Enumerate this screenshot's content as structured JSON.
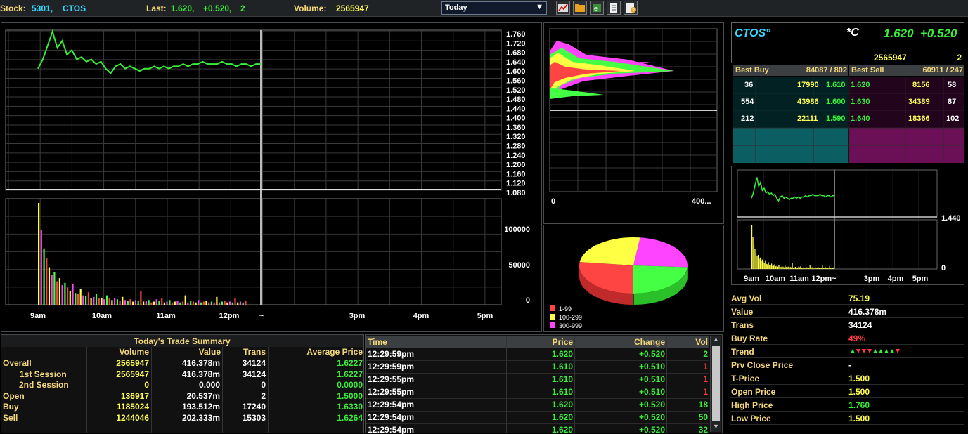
{
  "topbar": {
    "stock_label": "Stock:",
    "stock_code": "5301,",
    "stock_name": "CTOS",
    "last_label": "Last:",
    "last_price": "1.620,",
    "last_change": "+0.520,",
    "last_vol": "2",
    "volume_label": "Volume:",
    "volume": "2565947",
    "period": "Today",
    "icons": [
      "chart-icon",
      "folder-icon",
      "export-icon",
      "document-icon",
      "help-icon"
    ]
  },
  "price_chart": {
    "price_axis": [
      "1.760",
      "1.720",
      "1.680",
      "1.640",
      "1.600",
      "1.560",
      "1.520",
      "1.480",
      "1.440",
      "1.400",
      "1.360",
      "1.320",
      "1.280",
      "1.240",
      "1.200",
      "1.160",
      "1.120",
      "1.080"
    ],
    "volume_axis": [
      "100000",
      "50000",
      "0"
    ],
    "time_axis": [
      "9am",
      "10am",
      "11am",
      "12pm",
      "~",
      "3pm",
      "4pm",
      "5pm"
    ]
  },
  "chart_data": [
    {
      "type": "line",
      "name": "intraday-price",
      "x_range": [
        "9am",
        "5pm"
      ],
      "ylim": [
        1.08,
        1.76
      ],
      "prices": [
        1.6,
        1.64,
        1.7,
        1.76,
        1.69,
        1.72,
        1.66,
        1.68,
        1.64,
        1.65,
        1.63,
        1.64,
        1.62,
        1.63,
        1.6,
        1.58,
        1.61,
        1.62,
        1.6,
        1.61,
        1.6,
        1.59,
        1.6,
        1.6,
        1.61,
        1.6,
        1.61,
        1.6,
        1.61,
        1.61,
        1.62,
        1.61,
        1.62,
        1.62,
        1.63,
        1.62,
        1.62,
        1.62,
        1.63,
        1.62,
        1.62,
        1.61,
        1.62,
        1.62,
        1.61,
        1.62,
        1.62
      ]
    },
    {
      "type": "bar",
      "name": "intraday-volume",
      "ylim": [
        0,
        130000
      ],
      "values": [
        130000,
        95000,
        72000,
        60000,
        48000,
        38000,
        42000,
        30000,
        34000,
        25000,
        28000,
        22000,
        18000,
        26000,
        15000,
        14000,
        20000,
        12000,
        11000,
        16000,
        9000,
        10000,
        14000,
        8000,
        9000,
        7000,
        12000,
        8000,
        6000,
        9000,
        7000,
        5000,
        10000,
        6000,
        5000,
        7000,
        4000,
        6000,
        5000,
        18000,
        4000,
        5000,
        6000,
        3000,
        4000,
        7000,
        5000,
        8000,
        3000,
        4000,
        6000,
        3000,
        4000,
        5000,
        3000,
        4000,
        12000,
        3000,
        5000,
        4000,
        3000,
        6000,
        3000,
        4000,
        5000,
        3000,
        4000,
        3000,
        10000,
        3000,
        4000,
        5000,
        3000,
        4000,
        3000,
        9000,
        3000,
        4000,
        3000,
        5000
      ]
    },
    {
      "type": "area",
      "name": "volume-at-price",
      "x_axis": [
        "0",
        "400..."
      ]
    },
    {
      "type": "pie",
      "name": "trade-size-distribution",
      "categories": [
        "1-99",
        "100-299",
        "300-999"
      ],
      "values": [
        27,
        25,
        24,
        24
      ],
      "colors": [
        "#ff4444",
        "#ffff44",
        "#ff44ff",
        "#44ff44"
      ]
    },
    {
      "type": "line",
      "name": "mini-chart",
      "price_label": "1.440",
      "volume_label": "0",
      "time_axis": [
        "9am",
        "10am",
        "11am",
        "12pm~",
        "3pm",
        "4pm",
        "5pm"
      ]
    }
  ],
  "quote": {
    "symbol": "CTOS°",
    "flag": "*C",
    "last": "1.620",
    "change": "+0.520",
    "volume": "2565947",
    "orders": "2",
    "best_buy_label": "Best Buy",
    "best_buy_value": "84087 / 802",
    "best_sell_label": "Best Sell",
    "best_sell_value": "60911 / 247",
    "buy_levels": [
      {
        "count": "36",
        "qty": "17990",
        "price": "1.610"
      },
      {
        "count": "554",
        "qty": "43986",
        "price": "1.600"
      },
      {
        "count": "212",
        "qty": "22111",
        "price": "1.590"
      }
    ],
    "sell_levels": [
      {
        "price": "1.620",
        "qty": "8156",
        "count": "58"
      },
      {
        "price": "1.630",
        "qty": "34389",
        "count": "87"
      },
      {
        "price": "1.640",
        "qty": "18366",
        "count": "102"
      }
    ]
  },
  "stats": [
    {
      "label": "Avg Vol",
      "value": "75.19",
      "color": "#ffff55"
    },
    {
      "label": "Value",
      "value": "416.378m",
      "color": "#ffffff"
    },
    {
      "label": "Trans",
      "value": "34124",
      "color": "#ffffff"
    },
    {
      "label": "Buy Rate",
      "value": "49%",
      "color": "#ff3b3b"
    },
    {
      "label": "Trend",
      "value": "",
      "color": "#ffffff"
    },
    {
      "label": "Prv Close Price",
      "value": "-",
      "color": "#ffffff"
    },
    {
      "label": "T-Price",
      "value": "1.500",
      "color": "#ffff55"
    },
    {
      "label": "Open Price",
      "value": "1.500",
      "color": "#ffff55"
    },
    {
      "label": "High Price",
      "value": "1.760",
      "color": "#38ef38"
    },
    {
      "label": "Low Price",
      "value": "1.500",
      "color": "#ffff55"
    }
  ],
  "summary": {
    "title": "Today's Trade Summary",
    "headers": [
      "Volume",
      "Value",
      "Trans",
      "Average Price"
    ],
    "rows": [
      {
        "label": "Overall",
        "volume": "2565947",
        "value": "416.378m",
        "trans": "34124",
        "avg": "1.6227"
      },
      {
        "label": "1st Session",
        "volume": "2565947",
        "value": "416.378m",
        "trans": "34124",
        "avg": "1.6227"
      },
      {
        "label": "2nd Session",
        "volume": "0",
        "value": "0.000",
        "trans": "0",
        "avg": "0.0000"
      },
      {
        "label": "Open",
        "volume": "136917",
        "value": "20.537m",
        "trans": "2",
        "avg": "1.5000"
      },
      {
        "label": "Buy",
        "volume": "1185024",
        "value": "193.512m",
        "trans": "17240",
        "avg": "1.6330"
      },
      {
        "label": "Sell",
        "volume": "1244046",
        "value": "202.333m",
        "trans": "15303",
        "avg": "1.6264"
      }
    ]
  },
  "trade_log": {
    "headers": [
      "Time",
      "Price",
      "Change",
      "Vol"
    ],
    "rows": [
      {
        "time": "12:29:59pm",
        "price": "1.620",
        "change": "+0.520",
        "vol": "2",
        "vol_color": "#38ef38"
      },
      {
        "time": "12:29:59pm",
        "price": "1.610",
        "change": "+0.510",
        "vol": "1",
        "vol_color": "#ff3b3b"
      },
      {
        "time": "12:29:55pm",
        "price": "1.610",
        "change": "+0.510",
        "vol": "1",
        "vol_color": "#ff3b3b"
      },
      {
        "time": "12:29:55pm",
        "price": "1.610",
        "change": "+0.510",
        "vol": "1",
        "vol_color": "#ff3b3b"
      },
      {
        "time": "12:29:54pm",
        "price": "1.620",
        "change": "+0.520",
        "vol": "18",
        "vol_color": "#38ef38"
      },
      {
        "time": "12:29:54pm",
        "price": "1.620",
        "change": "+0.520",
        "vol": "50",
        "vol_color": "#38ef38"
      },
      {
        "time": "12:29:54pm",
        "price": "1.620",
        "change": "+0.520",
        "vol": "32",
        "vol_color": "#38ef38"
      }
    ]
  }
}
